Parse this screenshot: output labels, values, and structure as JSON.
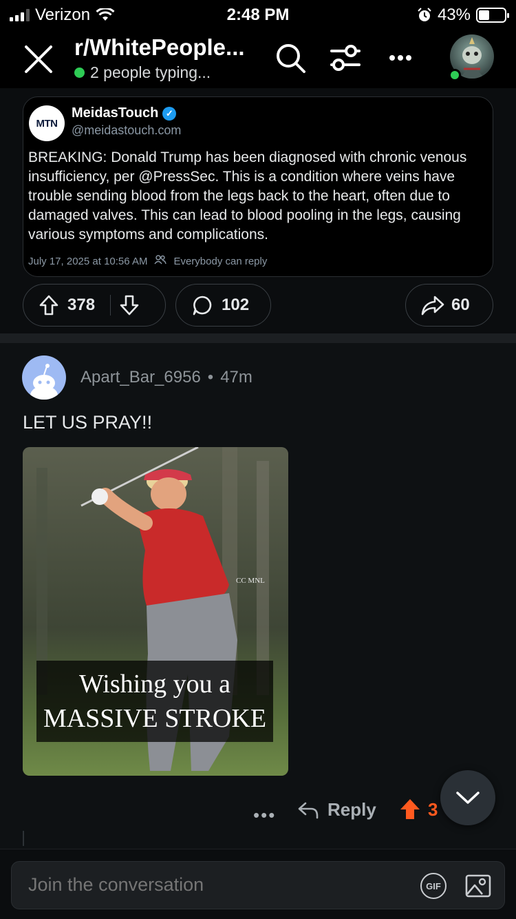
{
  "status_bar": {
    "carrier": "Verizon",
    "time": "2:48 PM",
    "battery": "43%",
    "battery_level": 0.43
  },
  "header": {
    "title": "r/WhitePeople...",
    "typing": "2 people typing..."
  },
  "tweet": {
    "logo_text": "MTN",
    "name": "MeidasTouch",
    "handle": "@meidastouch.com",
    "body": "BREAKING: Donald Trump has been diagnosed with chronic venous insufficiency, per @PressSec. This is a condition where veins have trouble sending blood from the legs back to the heart, often due to damaged valves. This can lead to blood pooling in the legs, causing various symptoms and complications.",
    "timestamp": "July 17, 2025 at 10:56 AM",
    "reply_setting": "Everybody can reply"
  },
  "post_actions": {
    "upvotes": "378",
    "comments": "102",
    "shares": "60"
  },
  "comment": {
    "username": "Apart_Bar_6956",
    "separator": "•",
    "age": "47m",
    "text": "LET US PRAY!!",
    "image": {
      "watermark": "CC MNL",
      "caption_line1": "Wishing you a",
      "caption_line2": "MASSIVE STROKE"
    },
    "actions": {
      "more": "•••",
      "reply": "Reply",
      "upvotes": "3"
    }
  },
  "composer": {
    "placeholder": "Join the conversation",
    "gif_label": "GIF"
  },
  "colors": {
    "online": "#2ecc55",
    "upvote": "#ff5a1f",
    "verified": "#1d9bf0",
    "background": "#0b0d0f"
  }
}
